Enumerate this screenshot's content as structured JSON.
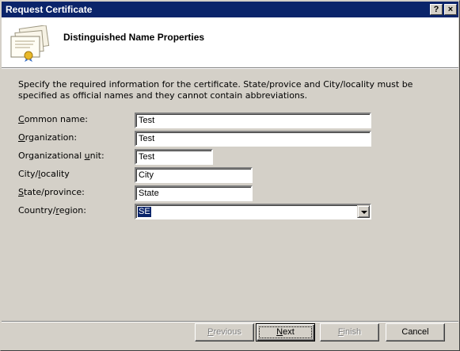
{
  "window": {
    "title": "Request Certificate",
    "help_label": "?",
    "close_label": "×"
  },
  "header": {
    "title": "Distinguished Name Properties",
    "icon": "certificate-icon"
  },
  "description": "Specify the required information for the certificate. State/provice and City/locality must be specified as official names and they cannot contain abbreviations.",
  "fields": {
    "common_name": {
      "label_u": "C",
      "label_rest": "ommon name:",
      "value": "Test"
    },
    "organization": {
      "label_u": "O",
      "label_rest": "rganization:",
      "value": "Test"
    },
    "organizational_unit": {
      "label_pre": "Organizational ",
      "label_u": "u",
      "label_rest": "nit:",
      "value": "Test"
    },
    "city": {
      "label_pre": "City/",
      "label_u": "l",
      "label_rest": "ocality",
      "value": "City"
    },
    "state": {
      "label_u": "S",
      "label_rest": "tate/province:",
      "value": "State"
    },
    "country": {
      "label_pre": "Country/",
      "label_u": "r",
      "label_rest": "egion:",
      "value": "SE"
    }
  },
  "buttons": {
    "previous": {
      "u": "P",
      "rest": "revious"
    },
    "next": {
      "u": "N",
      "rest": "ext"
    },
    "finish": {
      "u": "F",
      "rest": "inish"
    },
    "cancel": "Cancel"
  }
}
